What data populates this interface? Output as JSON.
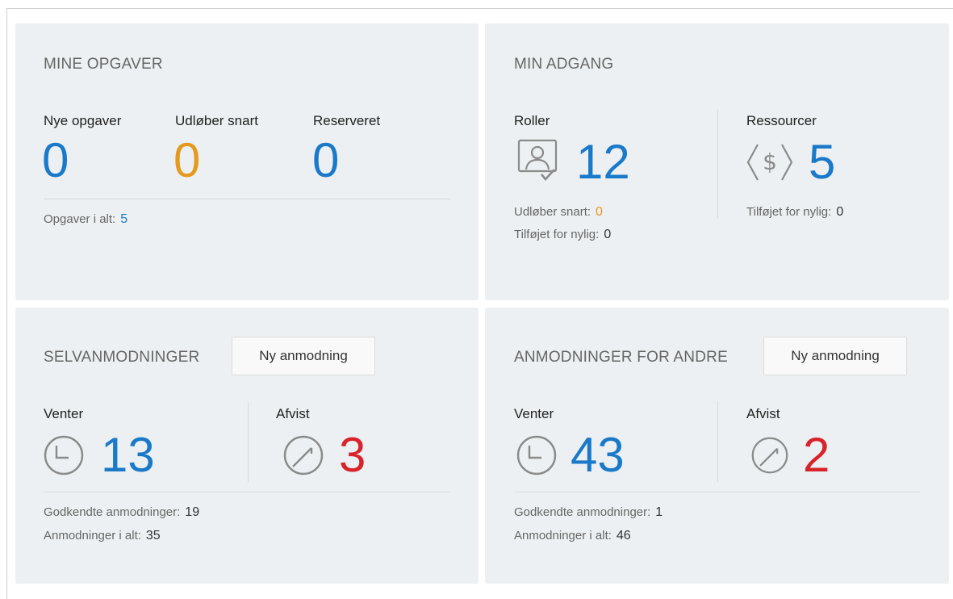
{
  "mine_opgaver": {
    "title": "MINE OPGAVER",
    "new_label": "Nye opgaver",
    "new_value": "0",
    "expiring_label": "Udløber snart",
    "expiring_value": "0",
    "reserved_label": "Reserveret",
    "reserved_value": "0",
    "total_label": "Opgaver i alt:",
    "total_value": "5"
  },
  "min_adgang": {
    "title": "MIN ADGANG",
    "roles_label": "Roller",
    "roles_value": "12",
    "roles_icon": "role-user-icon",
    "roles_expiring_label": "Udløber snart:",
    "roles_expiring_value": "0",
    "roles_added_label": "Tilføjet for nylig:",
    "roles_added_value": "0",
    "resources_label": "Ressourcer",
    "resources_value": "5",
    "resources_icon": "resource-dollar-icon",
    "resources_added_label": "Tilføjet for nylig:",
    "resources_added_value": "0"
  },
  "selvanmodninger": {
    "title": "SELVANMODNINGER",
    "button_label": "Ny anmodning",
    "pending_label": "Venter",
    "pending_value": "13",
    "rejected_label": "Afvist",
    "rejected_value": "3",
    "approved_label": "Godkendte anmodninger:",
    "approved_value": "19",
    "total_label": "Anmodninger i alt:",
    "total_value": "35"
  },
  "anmodninger_andre": {
    "title": "ANMODNINGER FOR ANDRE",
    "button_label": "Ny anmodning",
    "pending_label": "Venter",
    "pending_value": "43",
    "rejected_label": "Afvist",
    "rejected_value": "2",
    "approved_label": "Godkendte anmodninger:",
    "approved_value": "1",
    "total_label": "Anmodninger i alt:",
    "total_value": "46"
  },
  "colors": {
    "card_bg": "#ecf0f2",
    "blue": "#1a7ac9",
    "orange": "#e59a1f",
    "red": "#d8232a"
  }
}
